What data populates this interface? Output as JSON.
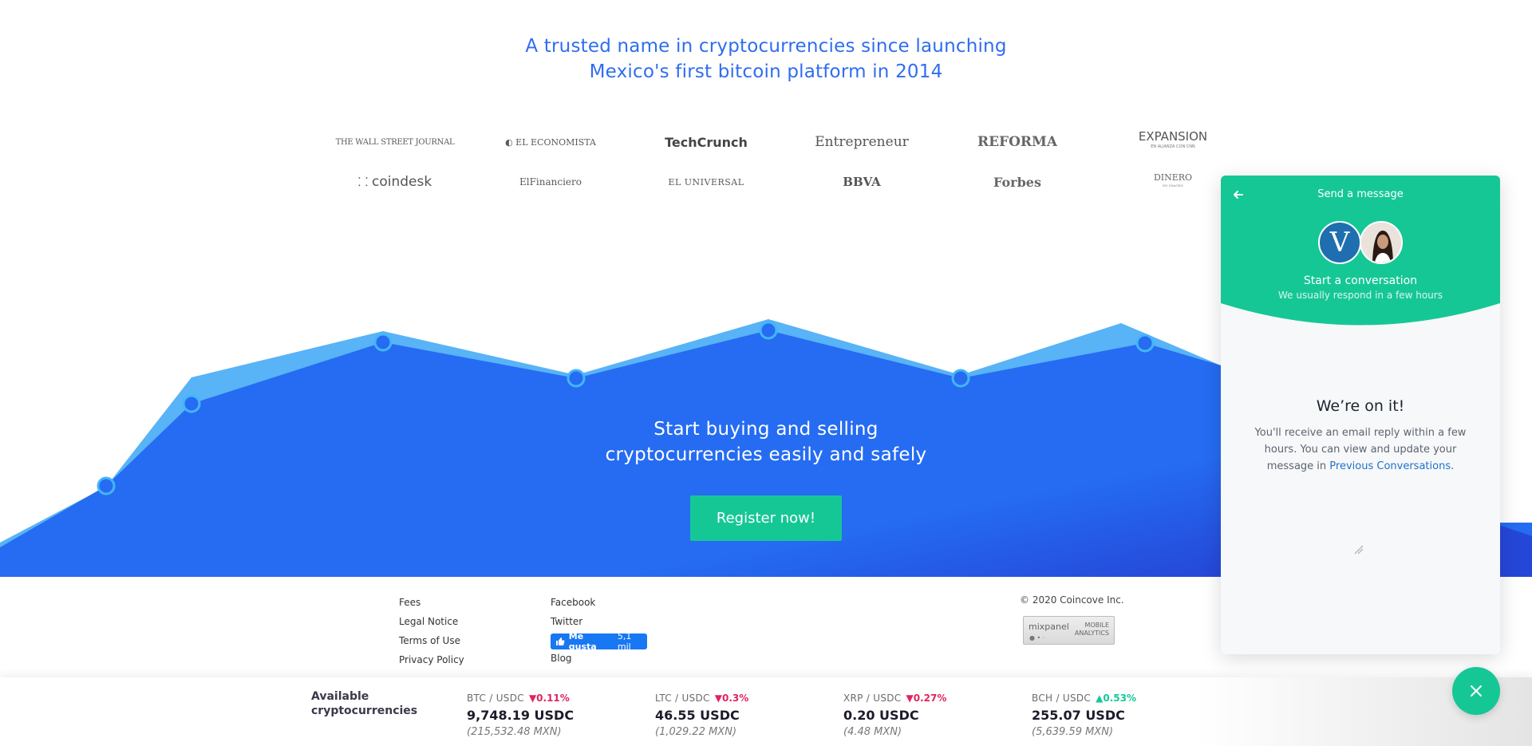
{
  "tagline": {
    "line1": "A trusted name in cryptocurrencies since launching",
    "line2": "Mexico's first bitcoin platform in 2014"
  },
  "press_logos": [
    {
      "name": "THE WALL STREET JOURNAL"
    },
    {
      "name": "EL ECONOMISTA"
    },
    {
      "name": "TechCrunch"
    },
    {
      "name": "Entrepreneur"
    },
    {
      "name": "REFORMA"
    },
    {
      "name": "EXPANSION",
      "sub": "EN ALIANZA CON CNN"
    },
    {
      "name": "coindesk"
    },
    {
      "name": "ElFinanciero"
    },
    {
      "name": "EL UNIVERSAL"
    },
    {
      "name": "BBVA"
    },
    {
      "name": "Forbes"
    },
    {
      "name": "DINERO",
      "sub": "EN IMAGEN"
    }
  ],
  "hero": {
    "title_line1": "Start buying and selling",
    "title_line2": "cryptocurrencies easily and safely",
    "register_label": "Register now!"
  },
  "footer": {
    "links_col1": [
      "Fees",
      "Legal Notice",
      "Terms of Use",
      "Privacy Policy"
    ],
    "links_col2": [
      "Facebook",
      "Twitter",
      "Blog"
    ],
    "fb_like_label": "Me gusta",
    "fb_like_count": "5,1 mil",
    "copyright": "© 2020 Coincove Inc.",
    "mixpanel_name": "mixpanel",
    "mixpanel_tag1": "MOBILE",
    "mixpanel_tag2": "ANALYTICS"
  },
  "ticker": {
    "title_line1": "Available",
    "title_line2": "cryptocurrencies",
    "coins": [
      {
        "pair": "BTC / USDC",
        "change": "▼0.11%",
        "direction": "down",
        "price": "9,748.19 USDC",
        "mxn": "(215,532.48 MXN)"
      },
      {
        "pair": "LTC / USDC",
        "change": "▼0.3%",
        "direction": "down",
        "price": "46.55 USDC",
        "mxn": "(1,029.22 MXN)"
      },
      {
        "pair": "XRP / USDC",
        "change": "▼0.27%",
        "direction": "down",
        "price": "0.20 USDC",
        "mxn": "(4.48 MXN)"
      },
      {
        "pair": "BCH / USDC",
        "change": "▲0.53%",
        "direction": "up",
        "price": "255.07 USDC",
        "mxn": "(5,639.59 MXN)"
      }
    ]
  },
  "chat": {
    "header_title": "Send a message",
    "avatar_letter": "V",
    "start_title": "Start a conversation",
    "start_sub": "We usually respond in a few hours",
    "confirm_title": "We’re on it!",
    "confirm_body": "You'll receive an email reply within a few hours. You can view and update your message in ",
    "confirm_link": "Previous Conversations.",
    "colors": {
      "accent": "#16c796",
      "link": "#1f73c8"
    }
  },
  "colors": {
    "brand_blue": "#2f6df0",
    "hero_blue": "#256cf2",
    "hero_light": "#58b3f7",
    "accent_green": "#16c796"
  }
}
